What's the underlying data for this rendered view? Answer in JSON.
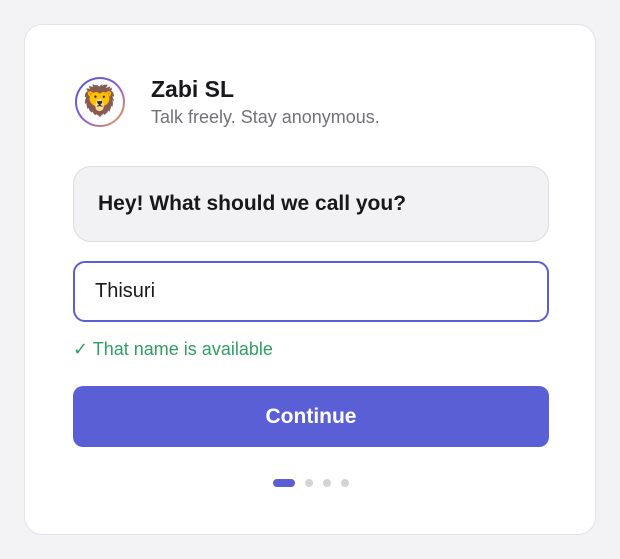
{
  "brand": {
    "avatar_emoji": "🦁",
    "avatar_icon": "lion-icon",
    "name": "Zabi SL",
    "tagline": "Talk freely. Stay anonymous."
  },
  "prompt": {
    "question": "Hey! What should we call you?"
  },
  "name_field": {
    "value": "Thisuri"
  },
  "validation": {
    "message": "✓ That name is available",
    "color": "#2f9e63"
  },
  "actions": {
    "continue_label": "Continue"
  },
  "progress": {
    "total_steps": 4,
    "current_step": 1
  },
  "colors": {
    "accent": "#5b5fd6",
    "success": "#2f9e63"
  }
}
